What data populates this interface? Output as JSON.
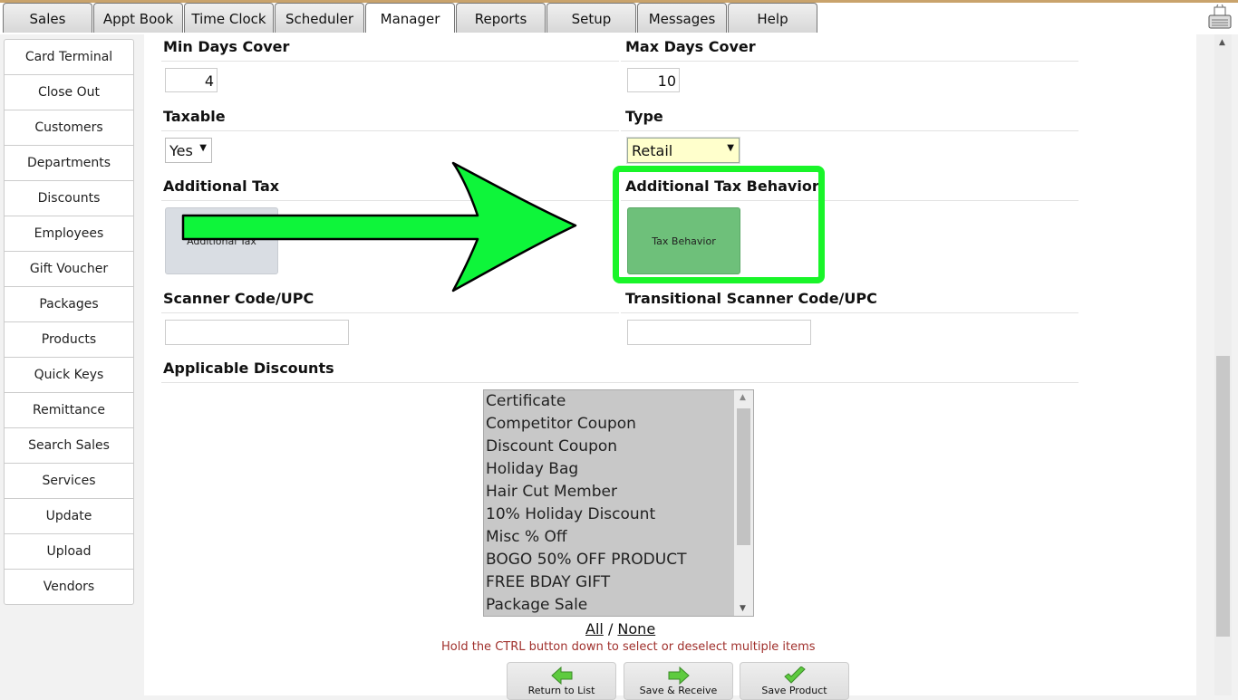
{
  "tabs": [
    {
      "label": "Sales",
      "active": false
    },
    {
      "label": "Appt Book",
      "active": false
    },
    {
      "label": "Time Clock",
      "active": false
    },
    {
      "label": "Scheduler",
      "active": false
    },
    {
      "label": "Manager",
      "active": true
    },
    {
      "label": "Reports",
      "active": false
    },
    {
      "label": "Setup",
      "active": false
    },
    {
      "label": "Messages",
      "active": false
    },
    {
      "label": "Help",
      "active": false
    }
  ],
  "sidebar": {
    "items": [
      "Card Terminal",
      "Close Out",
      "Customers",
      "Departments",
      "Discounts",
      "Employees",
      "Gift Voucher",
      "Packages",
      "Products",
      "Quick Keys",
      "Remittance",
      "Search Sales",
      "Services",
      "Update",
      "Upload",
      "Vendors"
    ]
  },
  "form": {
    "min_days_label": "Min Days Cover",
    "min_days_value": "4",
    "max_days_label": "Max Days Cover",
    "max_days_value": "10",
    "taxable_label": "Taxable",
    "taxable_value": "Yes",
    "type_label": "Type",
    "type_value": "Retail",
    "additional_tax_label": "Additional Tax",
    "additional_tax_button": "Additional Tax",
    "tax_behavior_label": "Additional Tax Behavior",
    "tax_behavior_button": "Tax Behavior",
    "scanner_label": "Scanner Code/UPC",
    "scanner_value": "",
    "transitional_label": "Transitional Scanner Code/UPC",
    "transitional_value": "",
    "discounts_label": "Applicable Discounts",
    "discounts": [
      "Certificate",
      "Competitor Coupon",
      "Discount Coupon",
      "Holiday Bag",
      "Hair Cut Member",
      "10% Holiday Discount",
      "Misc % Off",
      "BOGO 50% OFF PRODUCT",
      "FREE BDAY GIFT",
      "Package Sale"
    ],
    "all_link": "All",
    "separator": "/",
    "none_link": "None",
    "hint": "Hold the CTRL button down to select or deselect multiple items"
  },
  "actions": {
    "return_label": "Return to List",
    "save_receive_label": "Save & Receive",
    "save_product_label": "Save Product"
  },
  "icons": {
    "return": "green-left-arrow-icon",
    "save_receive": "green-right-arrow-icon",
    "save_product": "green-check-icon",
    "top_right": "print-icon"
  },
  "colors": {
    "annotation": "#19f529",
    "tax_behavior_button": "#6ec07a",
    "type_select_bg": "#ffffcc",
    "hint_text": "#a0302c"
  }
}
